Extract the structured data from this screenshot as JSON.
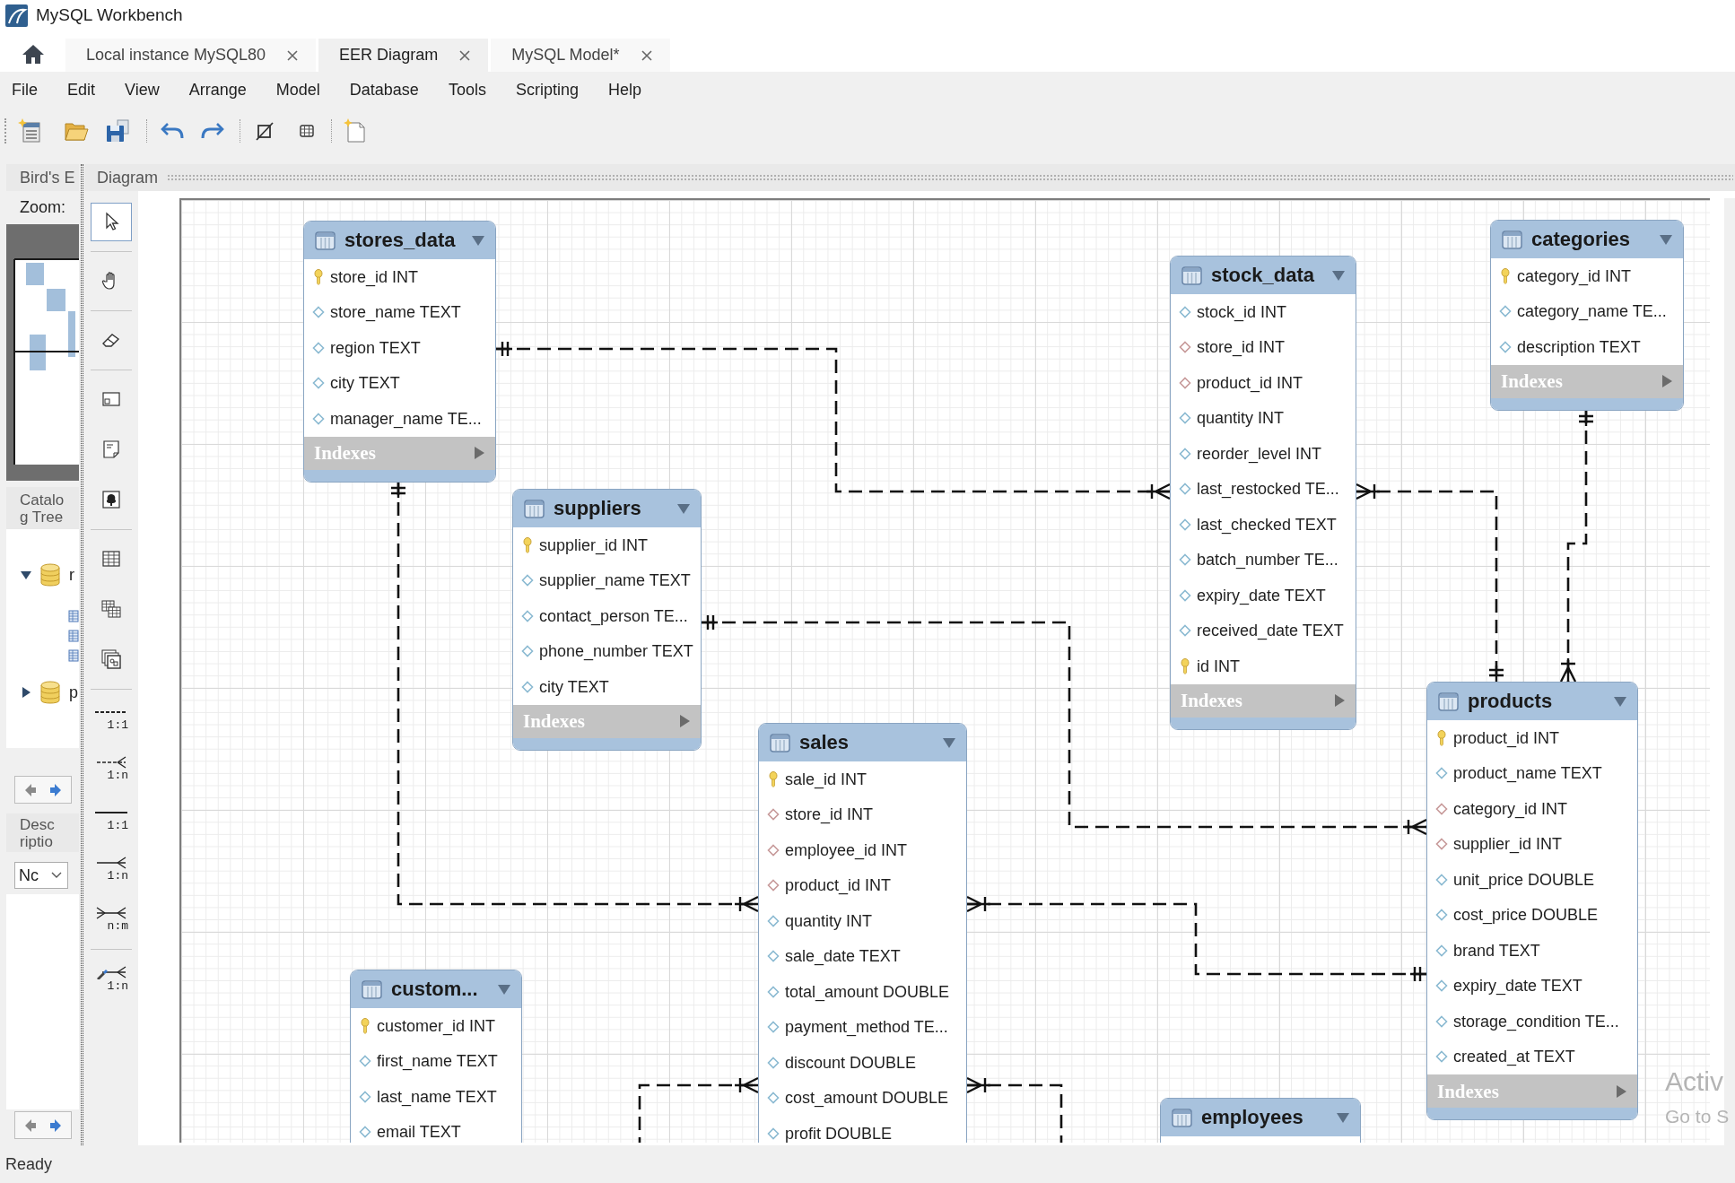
{
  "window": {
    "title": "MySQL Workbench"
  },
  "tabs": [
    {
      "label": "Local instance MySQL80",
      "selected": false
    },
    {
      "label": "EER Diagram",
      "selected": true
    },
    {
      "label": "MySQL Model*",
      "selected": false
    }
  ],
  "menu": [
    "File",
    "Edit",
    "View",
    "Arrange",
    "Model",
    "Database",
    "Tools",
    "Scripting",
    "Help"
  ],
  "side_panel": {
    "birds_eye_tab": "Bird's E",
    "zoom_label": "Zoom:",
    "catalog_tab": "Catalog Tree",
    "catalog_tree": [
      {
        "label": "r",
        "expanded": true,
        "children": [
          {
            "kind": "table"
          },
          {
            "kind": "table"
          },
          {
            "kind": "table"
          }
        ]
      },
      {
        "label": "p",
        "expanded": false
      }
    ],
    "description_tab": "Descriptio",
    "description_select": "Nc"
  },
  "diagram": {
    "tab": "Diagram",
    "tool_palette": [
      {
        "kind": "pointer",
        "selected": true
      },
      {
        "kind": "hand",
        "selected": false
      },
      {
        "kind": "eraser",
        "selected": false
      },
      {
        "kind": "layer",
        "selected": false
      },
      {
        "kind": "note",
        "selected": false
      },
      {
        "kind": "image",
        "selected": false
      },
      {
        "kind": "table",
        "selected": false
      },
      {
        "kind": "view",
        "selected": false
      },
      {
        "kind": "routine_group",
        "selected": false
      },
      {
        "kind": "relation_dashed_one",
        "label": "1:1",
        "selected": false
      },
      {
        "kind": "relation_dashed_many",
        "label": "1:n",
        "selected": false
      },
      {
        "kind": "relation_one",
        "label": "1:1",
        "selected": false
      },
      {
        "kind": "relation_many",
        "label": "1:n",
        "selected": false
      },
      {
        "kind": "relation_many_many",
        "label": "n:m",
        "selected": false
      },
      {
        "kind": "relation_pick",
        "label": "1:n",
        "selected": false
      }
    ],
    "tables": [
      {
        "name": "stores_data",
        "columns": [
          {
            "text": "store_id INT",
            "kind": "primary"
          },
          {
            "text": "store_name TEXT",
            "kind": "column"
          },
          {
            "text": "region TEXT",
            "kind": "column"
          },
          {
            "text": "city TEXT",
            "kind": "column"
          },
          {
            "text": "manager_name TE...",
            "kind": "column"
          }
        ],
        "indexes_label": "Indexes"
      },
      {
        "name": "categories",
        "columns": [
          {
            "text": "category_id INT",
            "kind": "primary"
          },
          {
            "text": "category_name TE...",
            "kind": "column"
          },
          {
            "text": "description TEXT",
            "kind": "column"
          }
        ],
        "indexes_label": "Indexes"
      },
      {
        "name": "stock_data",
        "columns": [
          {
            "text": "stock_id INT",
            "kind": "column"
          },
          {
            "text": "store_id INT",
            "kind": "foreign"
          },
          {
            "text": "product_id INT",
            "kind": "foreign"
          },
          {
            "text": "quantity INT",
            "kind": "column"
          },
          {
            "text": "reorder_level INT",
            "kind": "column"
          },
          {
            "text": "last_restocked TE...",
            "kind": "column"
          },
          {
            "text": "last_checked TEXT",
            "kind": "column"
          },
          {
            "text": "batch_number TE...",
            "kind": "column"
          },
          {
            "text": "expiry_date TEXT",
            "kind": "column"
          },
          {
            "text": "received_date TEXT",
            "kind": "column"
          },
          {
            "text": "id INT",
            "kind": "primary"
          }
        ],
        "indexes_label": "Indexes"
      },
      {
        "name": "suppliers",
        "columns": [
          {
            "text": "supplier_id INT",
            "kind": "primary"
          },
          {
            "text": "supplier_name TEXT",
            "kind": "column"
          },
          {
            "text": "contact_person TE...",
            "kind": "column"
          },
          {
            "text": "phone_number TEXT",
            "kind": "column"
          },
          {
            "text": "city TEXT",
            "kind": "column"
          }
        ],
        "indexes_label": "Indexes"
      },
      {
        "name": "products",
        "columns": [
          {
            "text": "product_id INT",
            "kind": "primary"
          },
          {
            "text": "product_name TEXT",
            "kind": "column"
          },
          {
            "text": "category_id INT",
            "kind": "foreign"
          },
          {
            "text": "supplier_id INT",
            "kind": "foreign"
          },
          {
            "text": "unit_price DOUBLE",
            "kind": "column"
          },
          {
            "text": "cost_price DOUBLE",
            "kind": "column"
          },
          {
            "text": "brand TEXT",
            "kind": "column"
          },
          {
            "text": "expiry_date TEXT",
            "kind": "column"
          },
          {
            "text": "storage_condition TE...",
            "kind": "column"
          },
          {
            "text": "created_at TEXT",
            "kind": "column"
          }
        ],
        "indexes_label": "Indexes"
      },
      {
        "name": "custom...",
        "columns": [
          {
            "text": "customer_id INT",
            "kind": "primary"
          },
          {
            "text": "first_name TEXT",
            "kind": "column"
          },
          {
            "text": "last_name TEXT",
            "kind": "column"
          },
          {
            "text": "email TEXT",
            "kind": "column"
          }
        ]
      },
      {
        "name": "sales",
        "columns": [
          {
            "text": "sale_id INT",
            "kind": "primary"
          },
          {
            "text": "store_id INT",
            "kind": "foreign"
          },
          {
            "text": "employee_id INT",
            "kind": "foreign"
          },
          {
            "text": "product_id INT",
            "kind": "foreign"
          },
          {
            "text": "quantity INT",
            "kind": "column"
          },
          {
            "text": "sale_date TEXT",
            "kind": "column"
          },
          {
            "text": "total_amount DOUBLE",
            "kind": "column"
          },
          {
            "text": "payment_method TE...",
            "kind": "column"
          },
          {
            "text": "discount DOUBLE",
            "kind": "column"
          },
          {
            "text": "cost_amount DOUBLE",
            "kind": "column"
          },
          {
            "text": "profit DOUBLE",
            "kind": "column"
          }
        ]
      },
      {
        "name": "employees"
      }
    ]
  },
  "status_bar": {
    "text": "Ready"
  },
  "activation_notice": [
    "Activ",
    "Go to S"
  ]
}
